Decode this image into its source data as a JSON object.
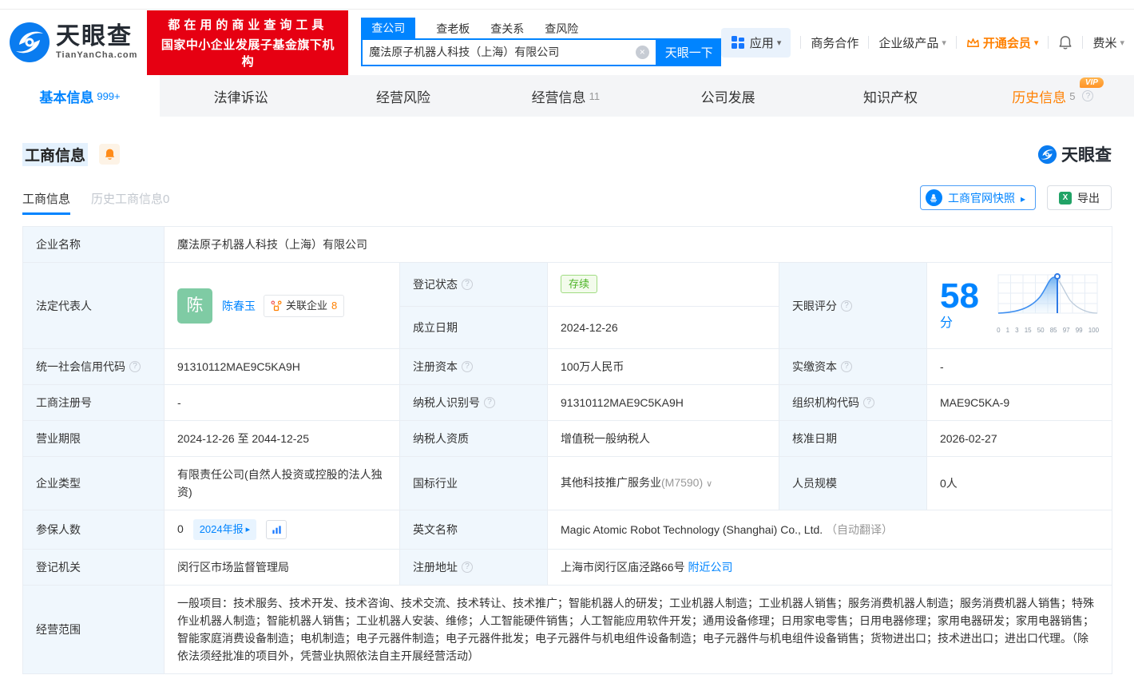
{
  "header": {
    "logo_title": "天眼查",
    "logo_domain": "TianYanCha.com",
    "slogan_line1": "都在用的商业查询工具",
    "slogan_line2": "国家中小企业发展子基金旗下机构",
    "search_tabs": [
      {
        "label": "查公司"
      },
      {
        "label": "查老板"
      },
      {
        "label": "查关系"
      },
      {
        "label": "查风险"
      }
    ],
    "search_value": "魔法原子机器人科技（上海）有限公司",
    "search_button": "天眼一下",
    "menu_apps": "应用",
    "menu_cooperation": "商务合作",
    "menu_enterprise": "企业级产品",
    "menu_vip": "开通会员",
    "menu_user": "费米"
  },
  "nav_tabs": [
    {
      "label": "基本信息",
      "count": "999+"
    },
    {
      "label": "法律诉讼",
      "count": ""
    },
    {
      "label": "经营风险",
      "count": ""
    },
    {
      "label": "经营信息",
      "count": "11"
    },
    {
      "label": "公司发展",
      "count": ""
    },
    {
      "label": "知识产权",
      "count": ""
    },
    {
      "label": "历史信息",
      "count": "5",
      "vip_badge": "VIP"
    }
  ],
  "section": {
    "title": "工商信息",
    "watermark": "天眼查",
    "subtab_current": "工商信息",
    "subtab_history": "历史工商信息0",
    "snapshot_button": "工商官网快照",
    "export_button": "导出"
  },
  "score": {
    "label": "天眼评分",
    "value": "58",
    "unit": "分",
    "ticks": [
      "0",
      "1",
      "3",
      "15",
      "50",
      "85",
      "97",
      "99",
      "100"
    ]
  },
  "fields": {
    "company_name": {
      "label": "企业名称",
      "value": "魔法原子机器人科技（上海）有限公司"
    },
    "legal_rep": {
      "label": "法定代表人",
      "avatar": "陈",
      "name": "陈春玉",
      "badge": "关联企业",
      "badge_count": "8"
    },
    "reg_status": {
      "label": "登记状态",
      "value": "存续"
    },
    "establish_date": {
      "label": "成立日期",
      "value": "2024-12-26"
    },
    "credit_code": {
      "label": "统一社会信用代码",
      "value": "91310112MAE9C5KA9H"
    },
    "reg_capital": {
      "label": "注册资本",
      "value": "100万人民币"
    },
    "paid_capital": {
      "label": "实缴资本",
      "value": "-"
    },
    "reg_number": {
      "label": "工商注册号",
      "value": "-"
    },
    "taxpayer_id": {
      "label": "纳税人识别号",
      "value": "91310112MAE9C5KA9H"
    },
    "org_code": {
      "label": "组织机构代码",
      "value": "MAE9C5KA-9"
    },
    "business_term": {
      "label": "营业期限",
      "value": "2024-12-26 至 2044-12-25"
    },
    "taxpayer_quality": {
      "label": "纳税人资质",
      "value": "增值税一般纳税人"
    },
    "approval_date": {
      "label": "核准日期",
      "value": "2026-02-27"
    },
    "company_type": {
      "label": "企业类型",
      "value": "有限责任公司(自然人投资或控股的法人独资)"
    },
    "industry": {
      "label": "国标行业",
      "value": "其他科技推广服务业",
      "code": "(M7590)"
    },
    "staff_size": {
      "label": "人员规模",
      "value": "0人"
    },
    "insured_count": {
      "label": "参保人数",
      "value": "0",
      "report_badge": "2024年报"
    },
    "english_name": {
      "label": "英文名称",
      "value": "Magic Atomic Robot Technology (Shanghai) Co., Ltd.",
      "note": "（自动翻译）"
    },
    "reg_authority": {
      "label": "登记机关",
      "value": "闵行区市场监督管理局"
    },
    "reg_address": {
      "label": "注册地址",
      "value": "上海市闵行区庙泾路66号",
      "nearby_link": "附近公司"
    },
    "business_scope": {
      "label": "经营范围",
      "value": "一般项目：技术服务、技术开发、技术咨询、技术交流、技术转让、技术推广；智能机器人的研发；工业机器人制造；工业机器人销售；服务消费机器人制造；服务消费机器人销售；特殊作业机器人制造；智能机器人销售；工业机器人安装、维修；人工智能硬件销售；人工智能应用软件开发；通用设备修理；日用家电零售；日用电器修理；家用电器研发；家用电器销售；智能家庭消费设备制造；电机制造；电子元器件制造；电子元器件批发；电子元器件与机电组件设备制造；电子元器件与机电组件设备销售；货物进出口；技术进出口；进出口代理。（除依法须经批准的项目外，凭营业执照依法自主开展经营活动）"
    }
  },
  "colors": {
    "brand_blue": "#0084ff",
    "banner_red": "#e60012",
    "vip_orange": "#ff8000",
    "status_green": "#4cb425"
  }
}
